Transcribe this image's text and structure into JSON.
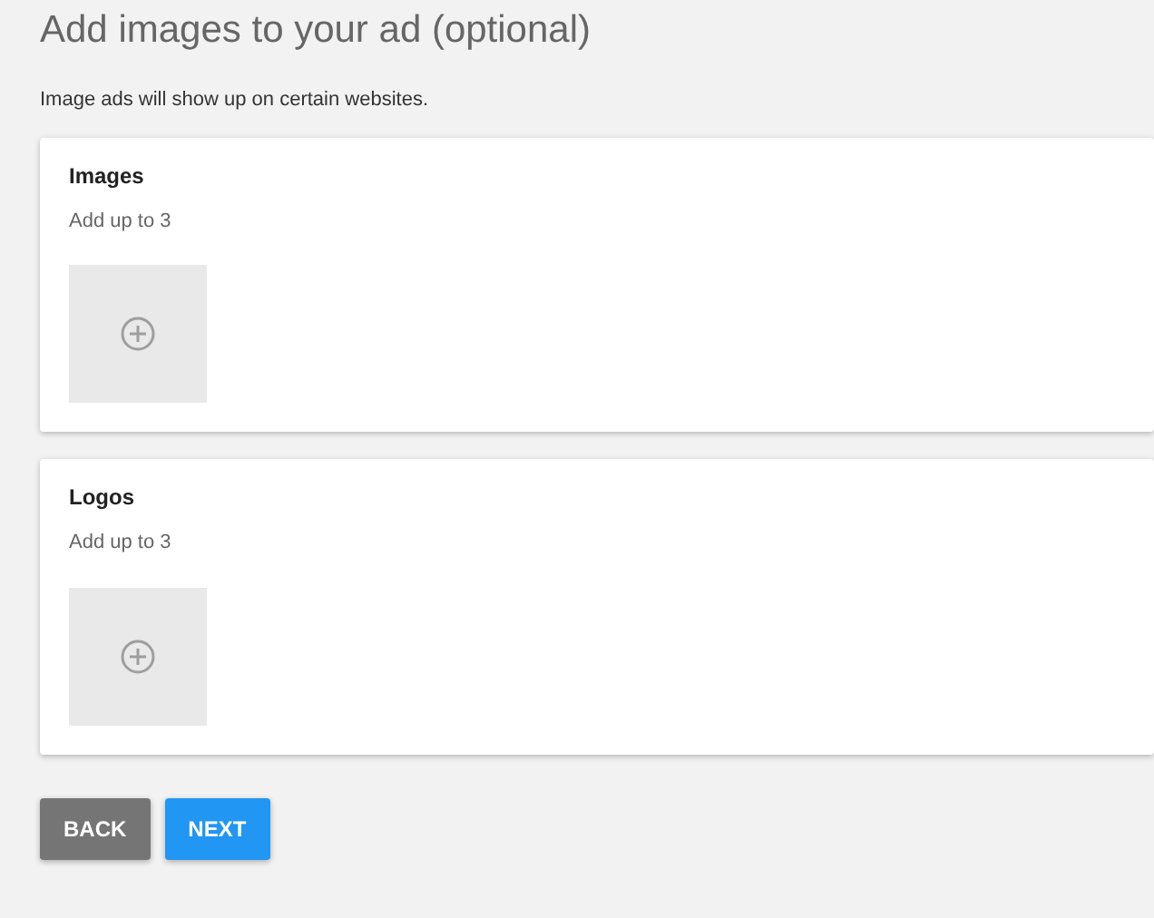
{
  "title": "Add images to your ad (optional)",
  "subtitle": "Image ads will show up on certain websites.",
  "sections": [
    {
      "heading": "Images",
      "hint": "Add up to 3"
    },
    {
      "heading": "Logos",
      "hint": "Add up to 3"
    }
  ],
  "buttons": [
    {
      "label": "BACK",
      "kind": "secondary"
    },
    {
      "label": "NEXT",
      "kind": "primary"
    }
  ]
}
